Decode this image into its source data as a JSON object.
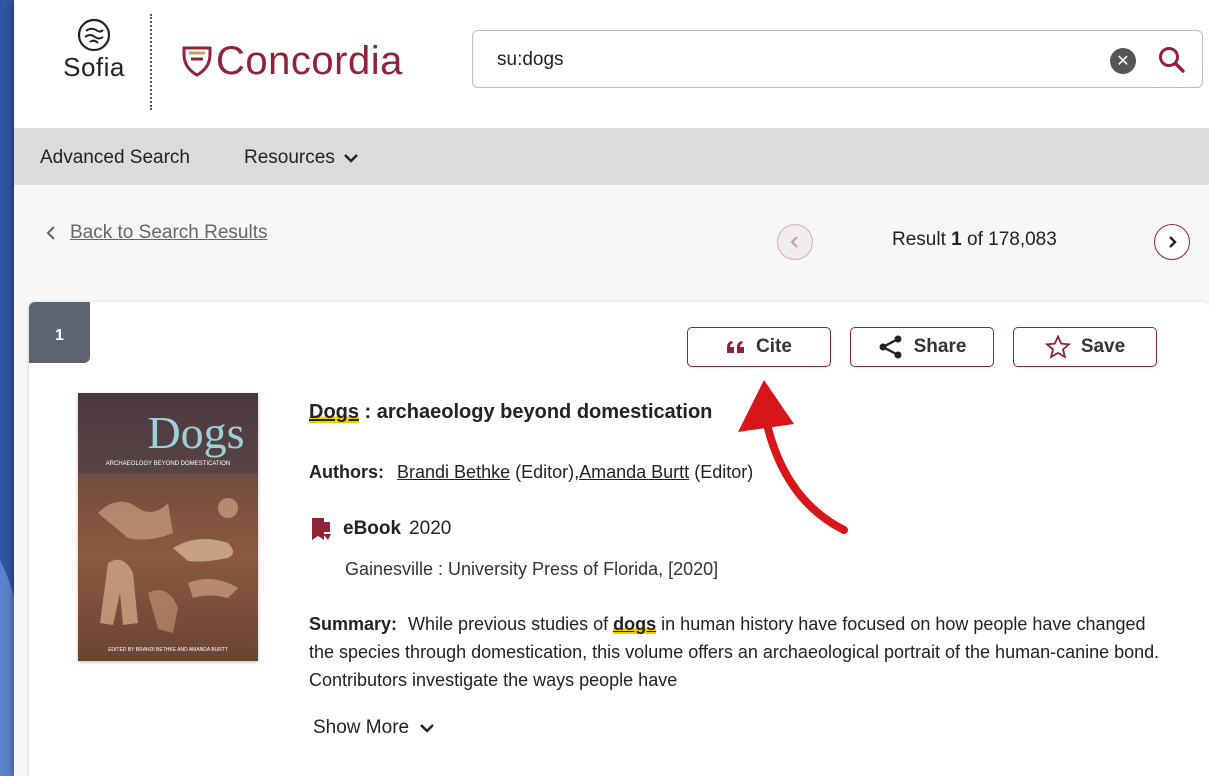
{
  "header": {
    "sofia_label": "Sofia",
    "concordia_label": "Concordia",
    "search": {
      "value": "su:dogs",
      "placeholder": ""
    }
  },
  "nav": {
    "advanced_search": "Advanced Search",
    "resources": "Resources"
  },
  "pagination": {
    "back_label": "Back to Search Results",
    "result_prefix": "Result",
    "result_current": "1",
    "result_of": "of",
    "result_total": "178,083"
  },
  "record": {
    "index": "1",
    "actions": {
      "cite": "Cite",
      "share": "Share",
      "save": "Save"
    },
    "title_highlight": "Dogs",
    "title_rest": " : archaeology beyond domestication",
    "authors_label": "Authors:",
    "authors": [
      {
        "name": "Brandi Bethke",
        "role": "(Editor),"
      },
      {
        "name": "Amanda Burtt",
        "role": "(Editor)"
      }
    ],
    "format": "eBook",
    "year": "2020",
    "publisher": "Gainesville : University Press of Florida, [2020]",
    "summary_label": "Summary:",
    "summary_pre": "While previous studies of",
    "summary_highlight": "dogs",
    "summary_post": "in human history have focused on how people have changed the species through domestication, this volume offers an archaeological portrait of the human-canine bond. Contributors investigate the ways people have",
    "show_more": "Show More",
    "cover": {
      "title": "Dogs",
      "subtitle": "ARCHAEOLOGY BEYOND DOMESTICATION",
      "editors": "EDITED BY BRANDI BETHKE AND AMANDA BURTT"
    }
  },
  "colors": {
    "brand": "#912338",
    "highlight": "#f5d000",
    "nav_bg": "#dcdcdc"
  }
}
